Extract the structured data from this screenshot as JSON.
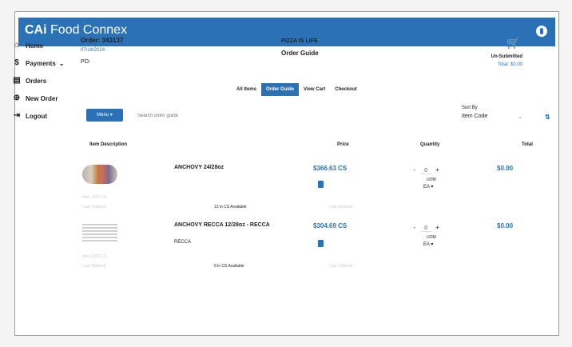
{
  "app": {
    "brand_prefix": "CAi",
    "brand_name": "Food Connex"
  },
  "sidebar": {
    "items": [
      {
        "label": "Home",
        "icon": "home-icon",
        "glyph": "⌂"
      },
      {
        "label": "Payments",
        "icon": "dollar-icon",
        "glyph": "$",
        "chevron": "⌄"
      },
      {
        "label": "Orders",
        "icon": "document-icon",
        "glyph": "▤"
      },
      {
        "label": "New Order",
        "icon": "plus-circle-icon",
        "glyph": "⊕"
      },
      {
        "label": "Logout",
        "icon": "logout-icon",
        "glyph": "⇥"
      }
    ]
  },
  "order": {
    "number": "Order: 343137",
    "sub": "07/14/2024",
    "po": "PO:",
    "store": "PIZZA IS LIFE",
    "guide_title": "Order Guide",
    "status": "Un-Submitted",
    "total": "Total: $0.00"
  },
  "tabs": [
    "All Items",
    "Order Guide",
    "View Cart",
    "Checkout"
  ],
  "active_tab": 1,
  "toolbar": {
    "menu_label": "Menu ▾",
    "search_placeholder": "Search order guide",
    "sort_label": "Sort By",
    "sort_value": "Item Code",
    "sort_chevron": "⌄",
    "sort_dir": "⇅"
  },
  "table": {
    "headers": [
      "Item Description",
      "Price",
      "Quantity",
      "Total"
    ],
    "rows": [
      {
        "name": "ANCHOVY 24/28oz",
        "brand": "",
        "price": "$366.63 CS",
        "caption": "Item 1001 CS",
        "avail_text": "13 in CS Available",
        "ghost_text": "Last Ordered",
        "qty": "0",
        "minus": "-",
        "plus": "+",
        "uom_label": "UOM",
        "uom": "EA ▾",
        "total": "$0.00"
      },
      {
        "name": "ANCHOVY RECCA 12/28oz - RECCA",
        "brand": "RECCA",
        "price": "$304.69 CS",
        "caption": "Item 1002 CS",
        "avail_text": "9 in CS Available",
        "ghost_text": "Last Ordered",
        "qty": "0",
        "minus": "-",
        "plus": "+",
        "uom_label": "UOM",
        "uom": "EA ▾",
        "total": "$0.00"
      }
    ]
  },
  "colors": {
    "accent": "#2a72b5",
    "cart": "#c23c80"
  }
}
